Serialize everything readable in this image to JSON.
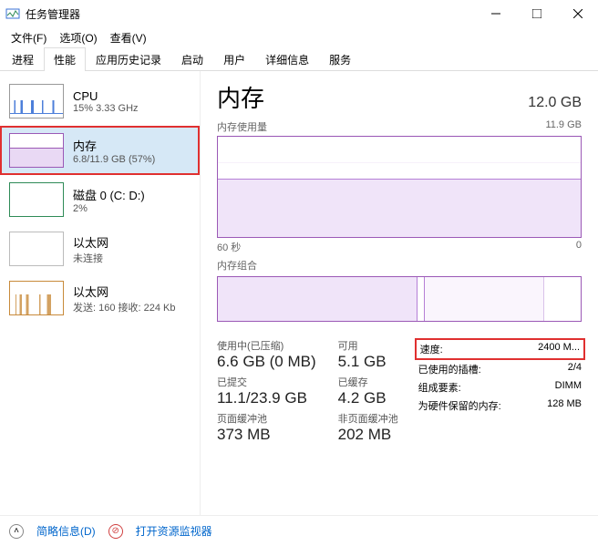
{
  "window": {
    "title": "任务管理器"
  },
  "menu": {
    "file": "文件(F)",
    "options": "选项(O)",
    "view": "查看(V)"
  },
  "tabs": [
    "进程",
    "性能",
    "应用历史记录",
    "启动",
    "用户",
    "详细信息",
    "服务"
  ],
  "active_tab": "性能",
  "sidebar": [
    {
      "name": "CPU",
      "sub": "15% 3.33 GHz"
    },
    {
      "name": "内存",
      "sub": "6.8/11.9 GB (57%)"
    },
    {
      "name": "磁盘 0 (C: D:)",
      "sub": "2%"
    },
    {
      "name": "以太网",
      "sub": "未连接"
    },
    {
      "name": "以太网",
      "sub": "发送: 160 接收: 224 Kb"
    }
  ],
  "main": {
    "title": "内存",
    "total": "12.0 GB",
    "usage_label": "内存使用量",
    "usage_max": "11.9 GB",
    "x_left": "60 秒",
    "x_right": "0",
    "comp_label": "内存组合"
  },
  "stats_left": {
    "l0": "使用中(已压缩)",
    "v0": "6.6 GB (0 MB)",
    "l1": "可用",
    "v1": "5.1 GB",
    "l2": "已提交",
    "v2": "11.1/23.9 GB",
    "l3": "已缓存",
    "v3": "4.2 GB",
    "l4": "页面缓冲池",
    "v4": "373 MB",
    "l5": "非页面缓冲池",
    "v5": "202 MB"
  },
  "stats_right": [
    {
      "k": "速度:",
      "v": "2400 M...",
      "hl": true
    },
    {
      "k": "已使用的插槽:",
      "v": "2/4"
    },
    {
      "k": "组成要素:",
      "v": "DIMM"
    },
    {
      "k": "为硬件保留的内存:",
      "v": "128 MB"
    }
  ],
  "footer": {
    "simple": "简略信息(D)",
    "resmon": "打开资源监视器"
  }
}
